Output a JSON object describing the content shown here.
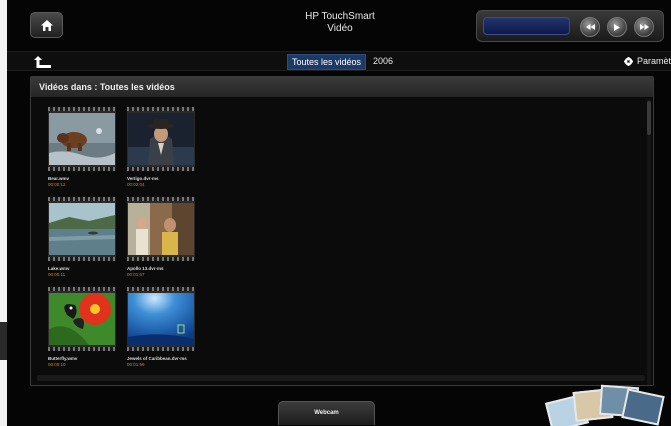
{
  "header": {
    "app_name": "HP TouchSmart",
    "section": "Vidéo",
    "home_icon": "home-icon",
    "media_controls": [
      "rewind-icon",
      "play-icon",
      "fast-forward-icon"
    ]
  },
  "nav": {
    "back_icon": "back-arrow-icon",
    "tabs": [
      {
        "label": "Toutes les vidéos",
        "active": true
      },
      {
        "label": "2006",
        "active": false
      }
    ],
    "settings_label": "Paramètres",
    "settings_icon": "gear-icon"
  },
  "panel": {
    "title": "Vidéos dans : Toutes les vidéos"
  },
  "videos": [
    {
      "name": "Bear.wmv",
      "duration": "00:00:12",
      "thumb": "bear"
    },
    {
      "name": "Vertigo.dvr-ms",
      "duration": "00:02:04",
      "thumb": "vertigo"
    },
    {
      "name": "Lake.wmv",
      "duration": "00:00:11",
      "thumb": "lake"
    },
    {
      "name": "Apollo 13.dvr-ms",
      "duration": "00:01:57",
      "thumb": "apollo"
    },
    {
      "name": "Butterfly.wmv",
      "duration": "00:00:10",
      "thumb": "butterfly"
    },
    {
      "name": "Jewels of Caribbean.dvr-ms",
      "duration": "00:01:59",
      "thumb": "jewels"
    }
  ],
  "footer": {
    "webcam_label": "Webcam"
  },
  "colors": {
    "active_tab": "#1d3a66",
    "duration_text": "#c8891f",
    "media_display": "#23336b"
  }
}
